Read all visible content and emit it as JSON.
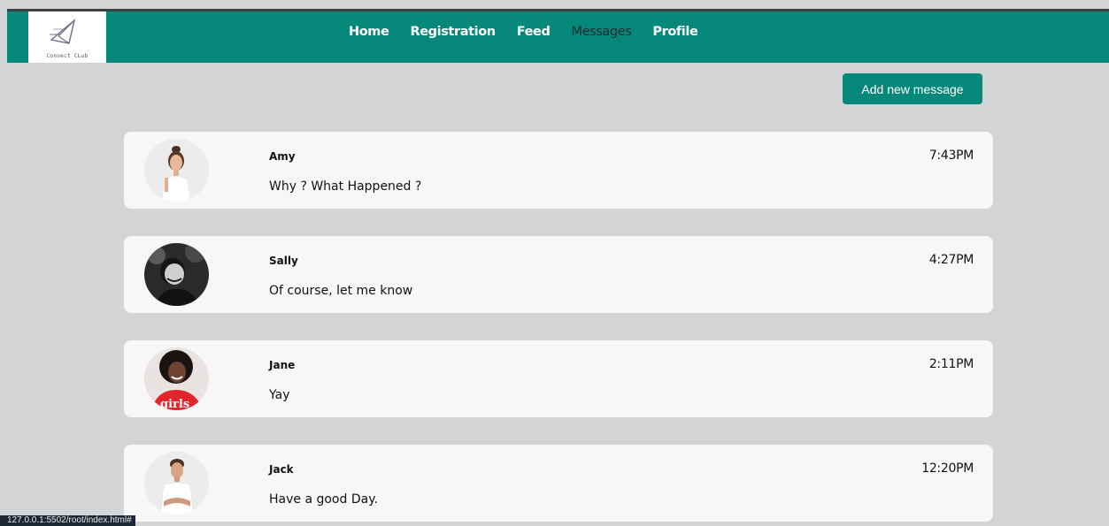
{
  "brand": {
    "logo_text": "Connect CLub"
  },
  "nav": {
    "links": [
      {
        "label": "Home"
      },
      {
        "label": "Registration"
      },
      {
        "label": "Feed"
      },
      {
        "label": "Messages"
      },
      {
        "label": "Profile"
      }
    ],
    "active": "Messages"
  },
  "actions": {
    "add_message_label": "Add new message"
  },
  "messages": [
    {
      "name": "Amy",
      "text": "Why ? What Happened ?",
      "time": "7:43PM",
      "avatar": "avatar-photo"
    },
    {
      "name": "Sally",
      "text": "Of course, let me know",
      "time": "4:27PM",
      "avatar": "avatar-photo"
    },
    {
      "name": "Jane",
      "text": "Yay",
      "time": "2:11PM",
      "avatar": "avatar-photo",
      "avatar_shirt_text": "girls"
    },
    {
      "name": "Jack",
      "text": "Have a good Day.",
      "time": "12:20PM",
      "avatar": "avatar-photo"
    }
  ],
  "status_bar": {
    "url": "127.0.0.1:5502/root/index.html#"
  },
  "colors": {
    "primary": "#05887a",
    "page_bg": "#d3d4d6",
    "card_bg": "#f7f7f8"
  }
}
